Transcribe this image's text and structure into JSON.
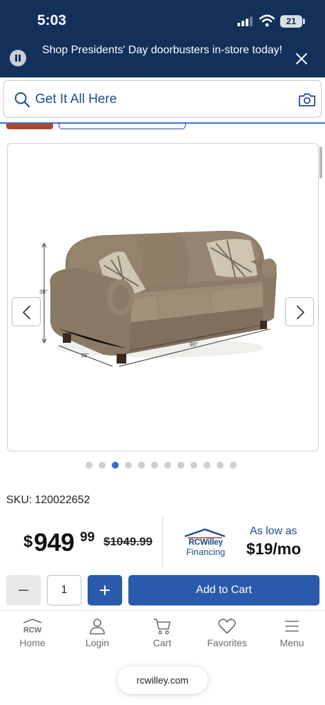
{
  "status_bar": {
    "time": "5:03",
    "battery": "21"
  },
  "promo": {
    "text": "Shop Presidents' Day doorbusters in-store today!"
  },
  "search": {
    "placeholder": "Get It All Here"
  },
  "product": {
    "dimensions": {
      "height": "38\"",
      "depth": "36\"",
      "width": "90\""
    },
    "carousel": {
      "dot_count": 12,
      "active_index": 2
    },
    "sku_label": "SKU:",
    "sku": "120022652",
    "price": {
      "currency": "$",
      "dollars": "949",
      "cents": "99",
      "was": "$1049.99"
    },
    "financing": {
      "brand": "RCWilley",
      "sub": "Financing",
      "as_low_as": "As low as",
      "monthly": "$19/mo"
    }
  },
  "cart": {
    "quantity": "1",
    "add_label": "Add to Cart"
  },
  "tabbar": {
    "items": [
      {
        "label": "Home",
        "logo": "RCW"
      },
      {
        "label": "Login"
      },
      {
        "label": "Cart"
      },
      {
        "label": "Favorites"
      },
      {
        "label": "Menu"
      }
    ]
  },
  "browser": {
    "url": "rcwilley.com"
  },
  "colors": {
    "navy": "#12305a",
    "accent": "#2a5aac",
    "active_dot": "#2f6fd6",
    "promo_red": "#b2482a"
  }
}
